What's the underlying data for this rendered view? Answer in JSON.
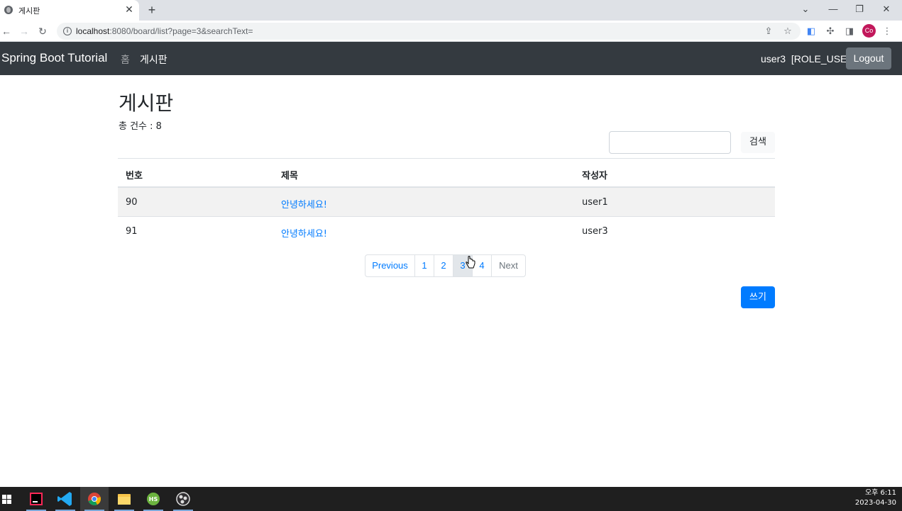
{
  "browser": {
    "tab_title": "게시판",
    "tab_close": "✕",
    "new_tab": "+",
    "url_host": "localhost",
    "url_rest": ":8080/board/list?page=3&searchText=",
    "profile_initials": "Co"
  },
  "navbar": {
    "brand": "Spring Boot Tutorial",
    "links": [
      "홈",
      "게시판"
    ],
    "user_name": "user3",
    "user_role": "[ROLE_USER]",
    "logout_label": "Logout"
  },
  "board": {
    "title": "게시판",
    "total_label": "총 건수 : 8",
    "search_value": "",
    "search_label": "검색",
    "columns": [
      "번호",
      "제목",
      "작성자"
    ],
    "rows": [
      {
        "id": "90",
        "title": "안녕하세요!",
        "author": "user1"
      },
      {
        "id": "91",
        "title": "안녕하세요!",
        "author": "user3"
      }
    ],
    "pagination": {
      "prev": "Previous",
      "pages": [
        "1",
        "2",
        "3",
        "4"
      ],
      "current": "3",
      "next": "Next"
    },
    "write_label": "쓰기"
  },
  "taskbar": {
    "time": "오후 6:11",
    "date": "2023-04-30"
  },
  "colors": {
    "navbar_bg": "#343a40",
    "primary": "#007bff",
    "secondary": "#6c757d"
  }
}
